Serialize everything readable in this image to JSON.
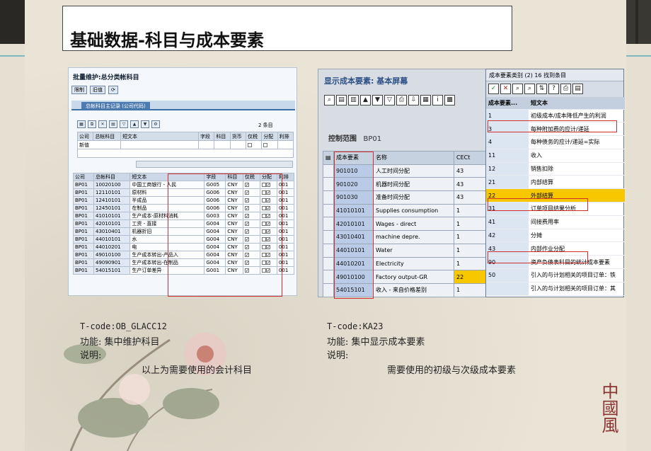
{
  "slide": {
    "title": "基础数据-科目与成本要素",
    "seal": "中國風"
  },
  "left": {
    "window_title": "批量维护:总分类帐科目",
    "toolbar": [
      "限制",
      "旧值"
    ],
    "tab": "总帐科目主记录 (公司代码)",
    "entries_label": "2 条目",
    "new_row": {
      "co": "新值"
    },
    "header1": [
      "公司",
      "总帐科目",
      "短文本",
      "字段",
      "科目",
      "货币",
      "仅税",
      "分配",
      "利排"
    ],
    "header2": [
      "公司",
      "总帐科目",
      "短文本",
      "字段",
      "科目",
      "仅税",
      "分配",
      "利排"
    ],
    "rows": [
      {
        "co": "BP01",
        "acct": "10020100",
        "text": "中国工商银行 - 人民",
        "fs": "G005",
        "cur": "CNY",
        "sort": "001"
      },
      {
        "co": "BP01",
        "acct": "12110101",
        "text": "原材料",
        "fs": "G006",
        "cur": "CNY",
        "sort": "001"
      },
      {
        "co": "BP01",
        "acct": "12410101",
        "text": "半成品",
        "fs": "G006",
        "cur": "CNY",
        "sort": "001"
      },
      {
        "co": "BP01",
        "acct": "12450101",
        "text": "在制品",
        "fs": "G006",
        "cur": "CNY",
        "sort": "001"
      },
      {
        "co": "BP01",
        "acct": "41010101",
        "text": "生产成本-原材料消耗",
        "fs": "G003",
        "cur": "CNY",
        "sort": "001"
      },
      {
        "co": "BP01",
        "acct": "42010101",
        "text": "工资 - 直接",
        "fs": "G004",
        "cur": "CNY",
        "sort": "001"
      },
      {
        "co": "BP01",
        "acct": "43010401",
        "text": "机器折旧",
        "fs": "G004",
        "cur": "CNY",
        "sort": "001"
      },
      {
        "co": "BP01",
        "acct": "44010101",
        "text": "水",
        "fs": "G004",
        "cur": "CNY",
        "sort": "001"
      },
      {
        "co": "BP01",
        "acct": "44010201",
        "text": "电",
        "fs": "G004",
        "cur": "CNY",
        "sort": "001"
      },
      {
        "co": "BP01",
        "acct": "49010100",
        "text": "生产成本转出-产品入",
        "fs": "G004",
        "cur": "CNY",
        "sort": "001"
      },
      {
        "co": "BP01",
        "acct": "49090901",
        "text": "生产成本转出-在制品",
        "fs": "G004",
        "cur": "CNY",
        "sort": "001"
      },
      {
        "co": "BP01",
        "acct": "54015101",
        "text": "生产订单差异",
        "fs": "G001",
        "cur": "CNY",
        "sort": "001"
      }
    ]
  },
  "right": {
    "window_title": "显示成本要素: 基本屏幕",
    "control_area": "控制范围",
    "control_value": "BP01",
    "header": [
      "成本要素",
      "名称",
      "CECt"
    ],
    "rows": [
      {
        "ce": "901010",
        "name": "人工时间分配",
        "cat": "43"
      },
      {
        "ce": "901020",
        "name": "机器时间分配",
        "cat": "43"
      },
      {
        "ce": "901030",
        "name": "准备时间分配",
        "cat": "43"
      },
      {
        "ce": "41010101",
        "name": "Supplies consumption",
        "cat": "1"
      },
      {
        "ce": "42010101",
        "name": "Wages - direct",
        "cat": "1"
      },
      {
        "ce": "43010401",
        "name": "machine depre.",
        "cat": "1"
      },
      {
        "ce": "44010101",
        "name": "Water",
        "cat": "1"
      },
      {
        "ce": "44010201",
        "name": "Electricity",
        "cat": "1"
      },
      {
        "ce": "49010100",
        "name": "Factory output-GR",
        "cat": "22"
      },
      {
        "ce": "54015101",
        "name": "收入 - 来自价格差别",
        "cat": "1"
      }
    ]
  },
  "popup": {
    "title": "成本要素类别 (2)   16 找到条目",
    "header": [
      "成本要素...",
      "短文本"
    ],
    "rows": [
      {
        "n": "1",
        "t": "初级成本/成本降低产生的利润"
      },
      {
        "n": "3",
        "t": "每种附加费的应计/递延"
      },
      {
        "n": "4",
        "t": "每种债务的应计/递延=实际"
      },
      {
        "n": "11",
        "t": "收入"
      },
      {
        "n": "12",
        "t": "销售扣除"
      },
      {
        "n": "21",
        "t": "内部结算"
      },
      {
        "n": "22",
        "t": "外部结算"
      },
      {
        "n": "31",
        "t": "订单项目结果分析"
      },
      {
        "n": "41",
        "t": "间接费用率"
      },
      {
        "n": "42",
        "t": "分摊"
      },
      {
        "n": "43",
        "t": "内部作业分配"
      },
      {
        "n": "90",
        "t": "资产负债表科目的统计成本要素"
      },
      {
        "n": "50",
        "t": "引入的与计划相关的项目订单：铁"
      },
      {
        "n": "",
        "t": "引入的与计划相关的项目订单：其"
      }
    ]
  },
  "captions": {
    "left": {
      "tcode": "T-code:OB_GLACC12",
      "func": "功能: 集中维护科目",
      "note_label": "说明:",
      "note": "以上为需要使用的会计科目"
    },
    "right": {
      "tcode": "T-code:KA23",
      "func": "功能: 集中显示成本要素",
      "note_label": "说明:",
      "note": "需要使用的初级与次级成本要素"
    }
  }
}
